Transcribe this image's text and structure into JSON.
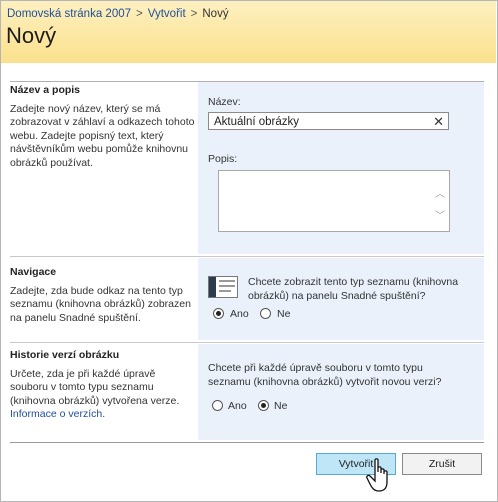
{
  "breadcrumb": {
    "home": "Domovská stránka 2007",
    "sep": ">",
    "create": "Vytvořit",
    "current": "Nový"
  },
  "page_title": "Nový",
  "name_section": {
    "heading": "Název a popis",
    "description": "Zadejte nový název, který se má zobrazovat v záhlaví a odkazech tohoto webu. Zadejte popisný text, který návštěvníkům webu pomůže knihovnu obrázků používat.",
    "name_label": "Název:",
    "name_value": "Aktuální obrázky",
    "desc_label": "Popis:",
    "desc_value": ""
  },
  "navigation_section": {
    "heading": "Navigace",
    "description": "Zadejte, zda bude odkaz na tento typ seznamu (knihovna obrázků) zobrazen na panelu Snadné spuštění.",
    "question": "Chcete zobrazit tento typ seznamu (knihovna obrázků) na panelu Snadné spuštění?",
    "yes_label": "Ano",
    "no_label": "Ne",
    "selected": "yes"
  },
  "version_section": {
    "heading": "Historie verzí obrázku",
    "description": "Určete, zda je při každé úpravě souboru v tomto typu seznamu (knihovna obrázků) vytvořena verze.",
    "link": "Informace o verzích.",
    "question": "Chcete při každé úpravě souboru v tomto typu seznamu (knihovna obrázků) vytvořit novou verzi?",
    "yes_label": "Ano",
    "no_label": "Ne",
    "selected": "no"
  },
  "buttons": {
    "create": "Vytvořit",
    "cancel": "Zrušit"
  },
  "colors": {
    "header_bg": "#fbe18d",
    "link": "#1f4e9b",
    "field_panel": "#eaf1fb",
    "primary_button": "#bfe6f7"
  }
}
